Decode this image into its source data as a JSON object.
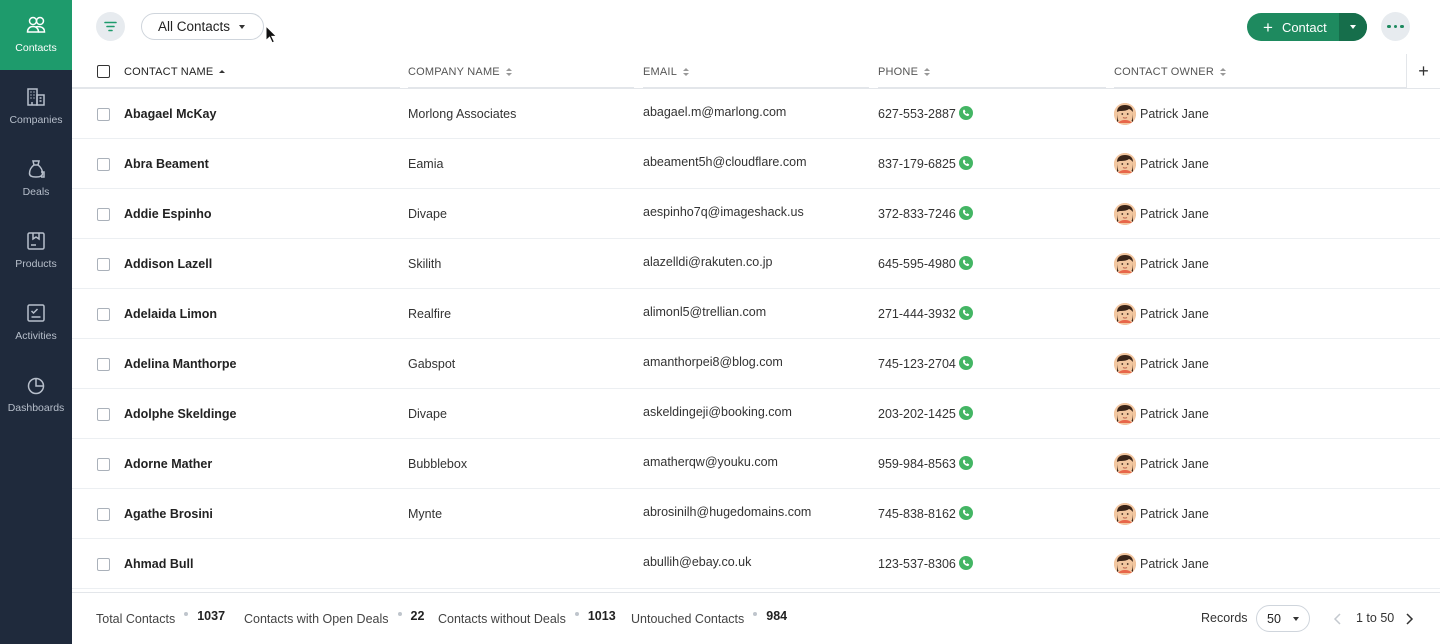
{
  "sidebar": {
    "items": [
      {
        "label": "Contacts",
        "icon": "contacts-icon",
        "active": true
      },
      {
        "label": "Companies",
        "icon": "companies-icon"
      },
      {
        "label": "Deals",
        "icon": "deals-icon"
      },
      {
        "label": "Products",
        "icon": "products-icon"
      },
      {
        "label": "Activities",
        "icon": "activities-icon"
      },
      {
        "label": "Dashboards",
        "icon": "dashboards-icon"
      }
    ]
  },
  "toolbar": {
    "view_label": "All Contacts",
    "add_label": "Contact"
  },
  "table": {
    "columns": [
      "CONTACT NAME",
      "COMPANY NAME",
      "EMAIL",
      "PHONE",
      "CONTACT OWNER"
    ],
    "rows": [
      {
        "name": "Abagael McKay",
        "company": "Morlong Associates",
        "email": "abagael.m@marlong.com",
        "phone": "627-553-2887",
        "owner": "Patrick Jane"
      },
      {
        "name": "Abra Beament",
        "company": "Eamia",
        "email": "abeament5h@cloudflare.com",
        "phone": "837-179-6825",
        "owner": "Patrick Jane"
      },
      {
        "name": "Addie Espinho",
        "company": "Divape",
        "email": "aespinho7q@imageshack.us",
        "phone": "372-833-7246",
        "owner": "Patrick Jane"
      },
      {
        "name": "Addison Lazell",
        "company": "Skilith",
        "email": "alazelldi@rakuten.co.jp",
        "phone": "645-595-4980",
        "owner": "Patrick Jane"
      },
      {
        "name": "Adelaida Limon",
        "company": "Realfire",
        "email": "alimonl5@trellian.com",
        "phone": "271-444-3932",
        "owner": "Patrick Jane"
      },
      {
        "name": "Adelina Manthorpe",
        "company": "Gabspot",
        "email": "amanthorpei8@blog.com",
        "phone": "745-123-2704",
        "owner": "Patrick Jane"
      },
      {
        "name": "Adolphe Skeldinge",
        "company": "Divape",
        "email": "askeldingeji@booking.com",
        "phone": "203-202-1425",
        "owner": "Patrick Jane"
      },
      {
        "name": "Adorne Mather",
        "company": "Bubblebox",
        "email": "amatherqw@youku.com",
        "phone": "959-984-8563",
        "owner": "Patrick Jane"
      },
      {
        "name": "Agathe Brosini",
        "company": "Mynte",
        "email": "abrosinilh@hugedomains.com",
        "phone": "745-838-8162",
        "owner": "Patrick Jane"
      },
      {
        "name": "Ahmad Bull",
        "company": "",
        "email": "abullih@ebay.co.uk",
        "phone": "123-537-8306",
        "owner": "Patrick Jane"
      }
    ]
  },
  "footer": {
    "stats": [
      {
        "label": "Total Contacts",
        "value": "1037"
      },
      {
        "label": "Contacts with Open Deals",
        "value": "22"
      },
      {
        "label": "Contacts without Deals",
        "value": "1013"
      },
      {
        "label": "Untouched Contacts",
        "value": "984"
      }
    ],
    "records_label": "Records",
    "records_per_page": "50",
    "pagination": "1 to 50"
  },
  "colors": {
    "sidebar_bg": "#1f2a3c",
    "accent": "#1e9b6c",
    "button_green": "#1e8a5f",
    "phone_green": "#43b564"
  }
}
